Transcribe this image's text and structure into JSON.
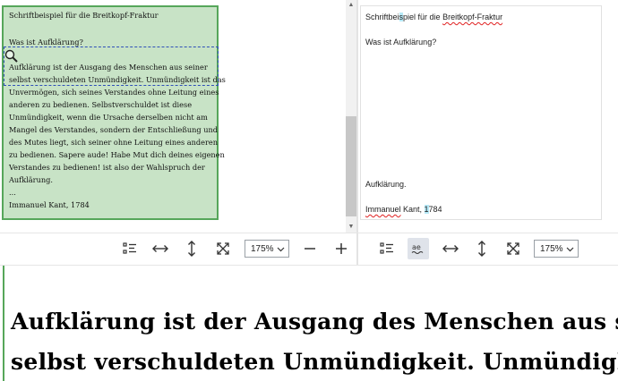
{
  "image_pane": {
    "lines": [
      "Schriftbeispiel für die Breitkopf-Fraktur",
      "Was ist Aufklärung?",
      "Aufklärung ist der Ausgang des Menschen aus seiner",
      "selbst verschuldeten Unmündigkeit. Unmündigkeit ist das",
      "Unvermögen, sich seines Verstandes ohne Leitung eines",
      "anderen zu bedienen. Selbstverschuldet ist diese",
      "Unmündigkeit, wenn die Ursache derselben nicht am",
      "Mangel des Verstandes, sondern der Entschließung und",
      "des Mutes liegt, sich seiner ohne Leitung eines anderen",
      "zu bedienen. Sapere aude! Habe Mut dich deines eigenen",
      "Verstandes zu bedienen! ist also der Wahlspruch der",
      "Aufklärung.",
      "...",
      "Immanuel Kant, 1784"
    ]
  },
  "text_pane": {
    "title_pre": "Schriftbei",
    "title_hl": "s",
    "title_mid": "piel für die ",
    "title_sq": "Breitkopf-Fraktur",
    "question": "Was ist Aufklärung?",
    "aufklaerung": "Aufklärung.",
    "author_sq": "Immanuel",
    "author_mid": " Kant, ",
    "author_hl": "1",
    "author_post": "784"
  },
  "left_toolbar": {
    "zoom": "175%",
    "icons": [
      "list-view-icon",
      "fit-width-icon",
      "fit-height-icon",
      "fit-page-icon",
      "zoom-out-icon",
      "zoom-in-icon"
    ]
  },
  "right_toolbar": {
    "zoom": "175%",
    "icons": [
      "list-view-icon",
      "text-wrap-icon",
      "fit-width-icon",
      "fit-height-icon",
      "fit-page-icon"
    ]
  },
  "preview": {
    "lines": [
      "Aufklärung ist der Ausgang des Menschen aus seiner",
      "selbst verschuldeten Unmündigkeit. Unmündigkeit ist das"
    ]
  },
  "colors": {
    "page_green": "#c8e3c6",
    "border_green": "#56a65a",
    "selection_blue": "#3050b8",
    "spell_red": "#e02020",
    "highlight_cyan": "#b6e9f7"
  }
}
